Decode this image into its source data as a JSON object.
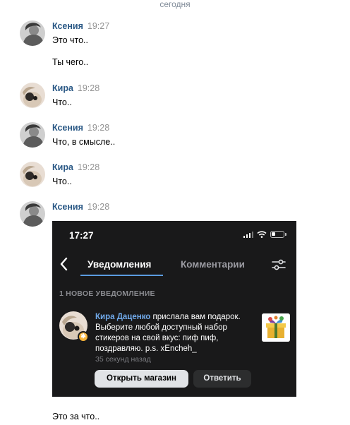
{
  "chat": {
    "date_separator": "сегодня",
    "messages": [
      {
        "author": "Ксения",
        "time": "19:27",
        "lines": [
          "Это что..",
          "Ты чего.."
        ]
      },
      {
        "author": "Кира",
        "time": "19:28",
        "lines": [
          "Что.."
        ]
      },
      {
        "author": "Ксения",
        "time": "19:28",
        "lines": [
          "Что, в смысле.."
        ]
      },
      {
        "author": "Кира",
        "time": "19:28",
        "lines": [
          "Что.."
        ]
      },
      {
        "author": "Ксения",
        "time": "19:28",
        "lines": [],
        "after_attachment": "Это за что.."
      }
    ]
  },
  "screenshot": {
    "status_time": "17:27",
    "tabs": [
      "Уведомления",
      "Комментарии"
    ],
    "section_title": "1 НОВОЕ УВЕДОМЛЕНИЕ",
    "notification": {
      "sender": "Кира Даценко",
      "text": " прислала вам подарок. Выберите любой доступный набор стикеров на свой вкус: пиф пиф, поздравляю. p.s. xEncheh_",
      "meta": "35 секунд назад"
    },
    "buttons": {
      "primary": "Открыть магазин",
      "secondary": "Ответить"
    }
  },
  "colors": {
    "author": "#2a5885",
    "accent": "#71aaeb",
    "dark_bg": "#19191a"
  }
}
